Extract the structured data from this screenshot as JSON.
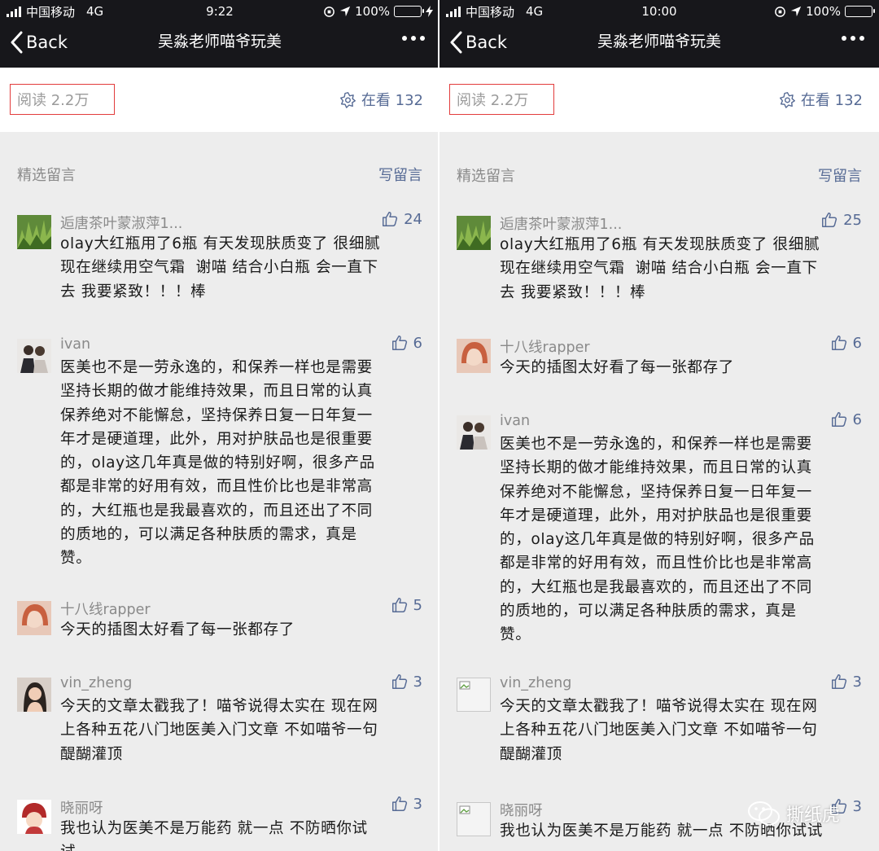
{
  "left": {
    "status": {
      "carrier": "中国移动",
      "network": "4G",
      "time": "9:22",
      "battery": "100%"
    },
    "nav": {
      "back": "Back",
      "title": "吴淼老师喵爷玩美"
    },
    "stats": {
      "read": "阅读 2.2万",
      "watching": "在看 132"
    },
    "section": {
      "title": "精选留言",
      "write": "写留言"
    },
    "comments": [
      {
        "name": "逅唐茶叶蒙淑萍1...",
        "likes": "24",
        "text": "olay大红瓶用了6瓶 有天发现肤质变了 很细腻\n现在继续用空气霜  谢喵 结合小白瓶 会一直下\n去 我要紧致！！！棒"
      },
      {
        "name": "ivan",
        "likes": "6",
        "text": "医美也不是一劳永逸的，和保养一样也是需要\n坚持长期的做才能维持效果，而且日常的认真\n保养绝对不能懈怠，坚持保养日复一日年复一\n年才是硬道理，此外，用对护肤品也是很重要\n的，olay这几年真是做的特别好啊，很多产品\n都是非常的好用有效，而且性价比也是非常高\n的，大红瓶也是我最喜欢的，而且还出了不同\n的质地的，可以满足各种肤质的需求，真是\n赞。"
      },
      {
        "name": "十八线rapper",
        "likes": "5",
        "text": "今天的插图太好看了每一张都存了"
      },
      {
        "name": "vin_zheng",
        "likes": "3",
        "text": "今天的文章太戳我了！喵爷说得太实在 现在网\n上各种五花八门地医美入门文章 不如喵爷一句\n醍醐灌顶"
      },
      {
        "name": "晓丽呀",
        "likes": "3",
        "text": "我也认为医美不是万能药 就一点 不防晒你试\n试"
      }
    ]
  },
  "right": {
    "status": {
      "carrier": "中国移动",
      "network": "4G",
      "time": "10:00",
      "battery": "100%"
    },
    "nav": {
      "back": "Back",
      "title": "吴淼老师喵爷玩美"
    },
    "stats": {
      "read": "阅读 2.2万",
      "watching": "在看 132"
    },
    "section": {
      "title": "精选留言",
      "write": "写留言"
    },
    "comments": [
      {
        "name": "逅唐茶叶蒙淑萍1...",
        "likes": "25",
        "text": "olay大红瓶用了6瓶 有天发现肤质变了 很细腻\n现在继续用空气霜  谢喵 结合小白瓶 会一直下\n去 我要紧致！！！棒"
      },
      {
        "name": "十八线rapper",
        "likes": "6",
        "text": "今天的插图太好看了每一张都存了"
      },
      {
        "name": "ivan",
        "likes": "6",
        "text": "医美也不是一劳永逸的，和保养一样也是需要\n坚持长期的做才能维持效果，而且日常的认真\n保养绝对不能懈怠，坚持保养日复一日年复一\n年才是硬道理，此外，用对护肤品也是很重要\n的，olay这几年真是做的特别好啊，很多产品\n都是非常的好用有效，而且性价比也是非常高\n的，大红瓶也是我最喜欢的，而且还出了不同\n的质地的，可以满足各种肤质的需求，真是\n赞。"
      },
      {
        "name": "vin_zheng",
        "likes": "3",
        "text": "今天的文章太戳我了！喵爷说得太实在 现在网\n上各种五花八门地医美入门文章 不如喵爷一句\n醍醐灌顶"
      },
      {
        "name": "晓丽呀",
        "likes": "3",
        "text": "我也认为医美不是万能药 就一点 不防晒你试试"
      }
    ]
  },
  "watermark": "撕纸虎",
  "colors": {
    "link": "#576b95",
    "navbar": "#17171b",
    "highlight_box": "#e23c3c",
    "battery": "#4cd964"
  }
}
